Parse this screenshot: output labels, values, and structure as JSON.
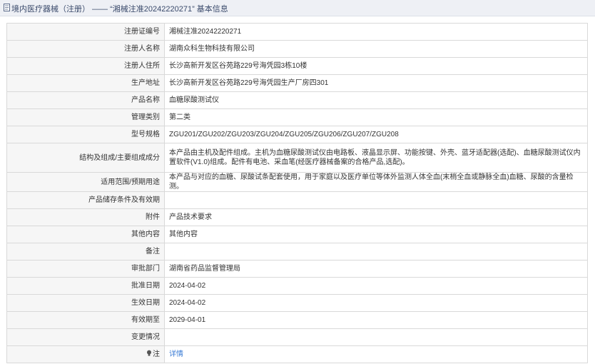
{
  "header": {
    "title": "境内医疗器械（注册） —— “湘械注准20242220271” 基本信息"
  },
  "rows": [
    {
      "label": "注册证编号",
      "value": "湘械注准20242220271"
    },
    {
      "label": "注册人名称",
      "value": "湖南众科生物科技有限公司"
    },
    {
      "label": "注册人住所",
      "value": "长沙高新开发区谷苑路229号海凭园3栋10楼"
    },
    {
      "label": "生产地址",
      "value": "长沙高新开发区谷苑路229号海凭园生产厂房四301"
    },
    {
      "label": "产品名称",
      "value": "血糖尿酸测试仪"
    },
    {
      "label": "管理类别",
      "value": "第二类"
    },
    {
      "label": "型号规格",
      "value": "ZGU201/ZGU202/ZGU203/ZGU204/ZGU205/ZGU206/ZGU207/ZGU208"
    },
    {
      "label": "结构及组成/主要组成成分",
      "value": "本产品由主机及配件组成。主机为血糖尿酸测试仪由电路板、液晶显示屏、功能按键、外壳、蓝牙适配器(选配)、血糖尿酸测试仪内置软件(V1.0)组成。配件有电池、采血笔(经医疗器械备案的合格产品,选配)。"
    },
    {
      "label": "适用范围/预期用途",
      "value": "本产品与对应的血糖、尿酸试条配套使用，用于家庭以及医疗单位等体外监测人体全血(末梢全血或静脉全血)血糖、尿酸的含量检测。"
    },
    {
      "label": "产品储存条件及有效期",
      "value": ""
    },
    {
      "label": "附件",
      "value": "产品技术要求"
    },
    {
      "label": "其他内容",
      "value": "其他内容"
    },
    {
      "label": "备注",
      "value": ""
    },
    {
      "label": "审批部门",
      "value": "湖南省药品监督管理局"
    },
    {
      "label": "批准日期",
      "value": "2024-04-02"
    },
    {
      "label": "生效日期",
      "value": "2024-04-02"
    },
    {
      "label": "有效期至",
      "value": "2029-04-01"
    },
    {
      "label": "变更情况",
      "value": ""
    }
  ],
  "note": {
    "label": "注",
    "icon": "lightbulb-icon",
    "link_text": "详情",
    "link_color": "#3a7bd5"
  }
}
